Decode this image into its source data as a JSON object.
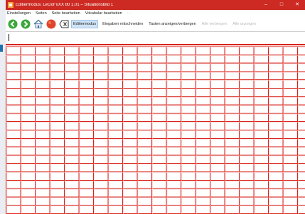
{
  "window": {
    "title": "Editiermodus: LeGoFoXX 80 1.01 – Situationsbild 1",
    "controls": {
      "minimize": "–",
      "maximize": "□",
      "close": "✕"
    }
  },
  "menu": [
    "Einstellungen",
    "Seiten",
    "Seite bearbeiten",
    "Vokabular bearbeiten",
    "···"
  ],
  "toolbar": {
    "icons": [
      "back-icon",
      "forward-icon",
      "home-icon",
      "stop-icon",
      "delete-icon"
    ],
    "buttons": [
      {
        "label": "Editiermodus",
        "state": "active"
      },
      {
        "label": "Eingaben mitschneiden",
        "state": "normal"
      },
      {
        "label": "Tasten anzeigen/verbergen",
        "state": "normal"
      },
      {
        "label": "Alle verbergen",
        "state": "disabled"
      },
      {
        "label": "Alle anzeigen",
        "state": "disabled"
      }
    ]
  },
  "input": {
    "value": ""
  },
  "colors": {
    "titlebar": "#cc2a22",
    "grid_line": "#d9231b",
    "active_button": "#cfe3f6"
  }
}
